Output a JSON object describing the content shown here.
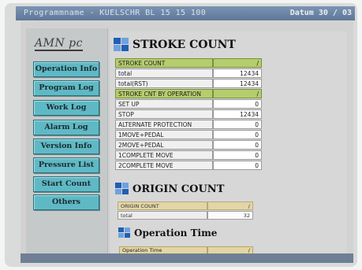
{
  "window": {
    "program_label": "Programmname - KUELSCHR BL 15 15 100",
    "date_label": "Datum  30 / 03"
  },
  "logo": {
    "text": "AMN pc"
  },
  "sidebar": {
    "items": [
      {
        "label": "Operation Info"
      },
      {
        "label": "Program Log"
      },
      {
        "label": "Work Log"
      },
      {
        "label": "Alarm Log"
      },
      {
        "label": "Version Info"
      },
      {
        "label": "Pressure List"
      },
      {
        "label": "Start Count"
      },
      {
        "label": "Others"
      }
    ]
  },
  "stroke_count": {
    "title": "STROKE COUNT",
    "header": {
      "label": "STROKE COUNT",
      "value": "/"
    },
    "rows": [
      {
        "label": "total",
        "value": "12434"
      },
      {
        "label": "total(RST)",
        "value": "12434"
      }
    ],
    "by_operation_header": {
      "label": "STROKE CNT BY OPERATION",
      "value": "/"
    },
    "by_operation": [
      {
        "label": "SET UP",
        "value": "0"
      },
      {
        "label": "STOP",
        "value": "12434"
      },
      {
        "label": "ALTERNATE PROTECTION",
        "value": "0"
      },
      {
        "label": "1MOVE+PEDAL",
        "value": "0"
      },
      {
        "label": "2MOVE+PEDAL",
        "value": "0"
      },
      {
        "label": "1COMPLETE MOVE",
        "value": "0"
      },
      {
        "label": "2COMPLETE MOVE",
        "value": "0"
      }
    ]
  },
  "origin_count": {
    "title": "ORIGIN COUNT",
    "header": {
      "label": "ORIGIN COUNT",
      "value": "/"
    },
    "rows": [
      {
        "label": "total",
        "value": "32"
      }
    ]
  },
  "operation_time": {
    "title": "Operation Time",
    "header": {
      "label": "Operation Time",
      "value": "/"
    }
  }
}
